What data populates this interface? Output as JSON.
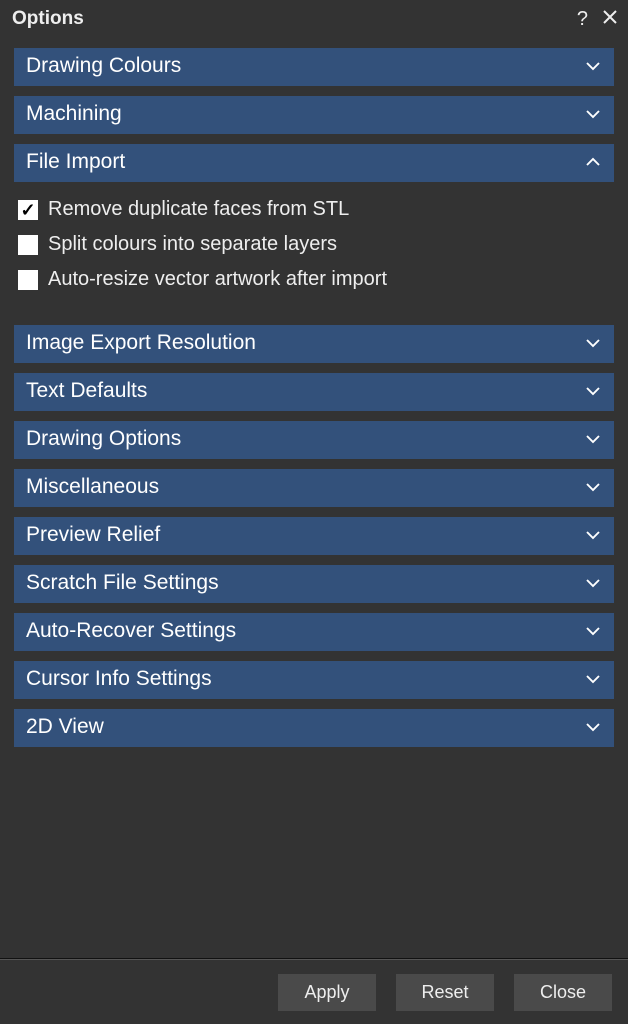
{
  "title": "Options",
  "sections": {
    "drawing_colours": {
      "label": "Drawing Colours",
      "expanded": false
    },
    "machining": {
      "label": "Machining",
      "expanded": false
    },
    "file_import": {
      "label": "File Import",
      "expanded": true,
      "options": [
        {
          "label": "Remove duplicate faces from STL",
          "checked": true
        },
        {
          "label": "Split colours into separate layers",
          "checked": false
        },
        {
          "label": "Auto-resize vector artwork after import",
          "checked": false
        }
      ]
    },
    "image_export_resolution": {
      "label": "Image Export Resolution",
      "expanded": false
    },
    "text_defaults": {
      "label": "Text Defaults",
      "expanded": false
    },
    "drawing_options": {
      "label": "Drawing Options",
      "expanded": false
    },
    "miscellaneous": {
      "label": "Miscellaneous",
      "expanded": false
    },
    "preview_relief": {
      "label": "Preview Relief",
      "expanded": false
    },
    "scratch_file_settings": {
      "label": "Scratch File Settings",
      "expanded": false
    },
    "auto_recover_settings": {
      "label": "Auto-Recover Settings",
      "expanded": false
    },
    "cursor_info_settings": {
      "label": "Cursor Info Settings",
      "expanded": false
    },
    "view_2d": {
      "label": "2D View",
      "expanded": false
    }
  },
  "footer": {
    "apply": "Apply",
    "reset": "Reset",
    "close": "Close"
  }
}
